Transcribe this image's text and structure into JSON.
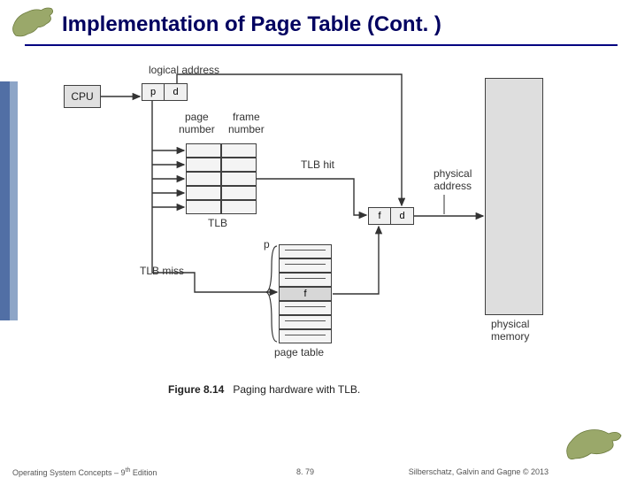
{
  "title": "Implementation of Page Table (Cont. )",
  "footer": {
    "left_prefix": "Operating System Concepts – 9",
    "left_sup": "th",
    "left_suffix": " Edition",
    "center": "8. 79",
    "right": "Silberschatz, Galvin and Gagne © 2013"
  },
  "diagram": {
    "logical_address_label": "logical address",
    "cpu_label": "CPU",
    "p": "p",
    "d": "d",
    "page_number_label": "page\nnumber",
    "frame_number_label": "frame\nnumber",
    "tlb_label": "TLB",
    "tlb_hit_label": "TLB hit",
    "tlb_miss_label": "TLB miss",
    "page_table_label": "page table",
    "f": "f",
    "physical_address_label": "physical\naddress",
    "physical_memory_label": "physical\nmemory",
    "caption_bold": "Figure 8.14",
    "caption_text": "Paging hardware with TLB."
  },
  "chart_data": {
    "type": "diagram",
    "description": "Paging hardware with TLB",
    "components": [
      {
        "name": "CPU",
        "outputs": [
          "logical address (p,d)"
        ]
      },
      {
        "name": "TLB",
        "columns": [
          "page number",
          "frame number"
        ],
        "rows": 5,
        "hit_output": "f",
        "miss_output": "p to page table"
      },
      {
        "name": "Page table",
        "indexed_by": "p",
        "output": "f"
      },
      {
        "name": "Physical address register",
        "fields": [
          "f",
          "d"
        ]
      },
      {
        "name": "Physical memory"
      }
    ],
    "flows": [
      "CPU -> (p,d)",
      "p -> TLB lookup",
      "TLB hit -> f",
      "TLB miss -> p indexes page table -> f",
      "d passes through unchanged",
      "(f,d) -> physical memory"
    ]
  }
}
